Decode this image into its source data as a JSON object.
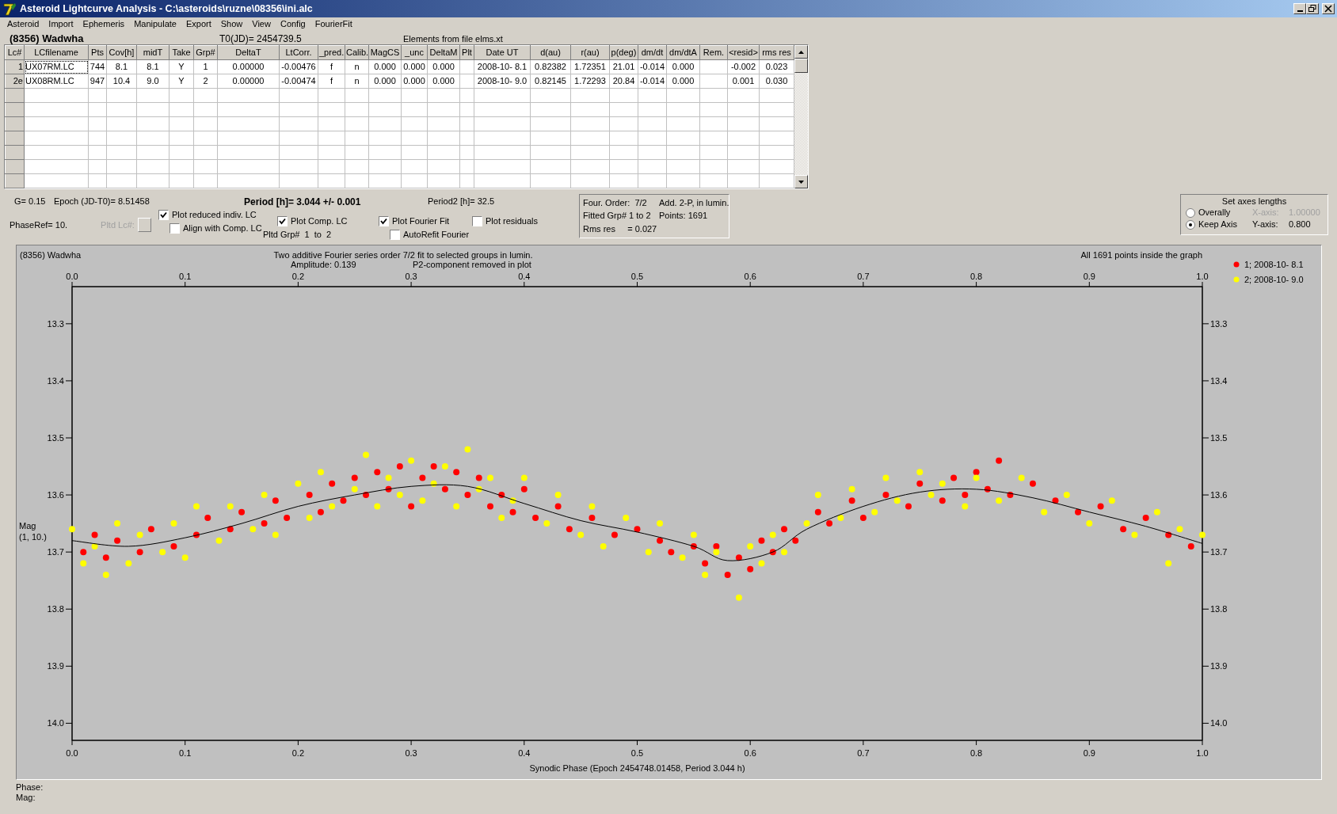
{
  "window": {
    "title": "Asteroid Lightcurve Analysis - C:\\asteroids\\ruzne\\08356\\ini.alc"
  },
  "menu": [
    "Asteroid",
    "Import",
    "Ephemeris",
    "Manipulate",
    "Export",
    "Show",
    "View",
    "Config",
    "FourierFit"
  ],
  "header": {
    "asteroid": "(8356) Wadwha",
    "t0": "T0(JD)= 2454739.5",
    "elements": "Elements from file elms.xt"
  },
  "table": {
    "columns": [
      "Lc#",
      "LCfilename",
      "Pts",
      "Cov[h]",
      "midT",
      "Take",
      "Grp#",
      "DeltaT",
      "LtCorr.",
      "_pred.",
      "Calib.",
      "MagCS",
      "_unc",
      "DeltaM",
      "Plt",
      "Date UT",
      "d(au)",
      "r(au)",
      "p(deg)",
      "dm/dt",
      "dm/dtA",
      "Rem.",
      "<resid>",
      "rms res"
    ],
    "rows": [
      {
        "focused": true,
        "cells": [
          "1",
          "UX07RM.LC",
          "744",
          "8.1",
          "8.1",
          "Y",
          "1",
          "0.00000",
          "-0.00476",
          "f",
          "n",
          "0.000",
          "0.000",
          "0.000",
          "",
          "2008-10- 8.1",
          "0.82382",
          "1.72351",
          "21.01",
          "-0.014",
          "0.000",
          "",
          "-0.002",
          "0.023"
        ]
      },
      {
        "focused": false,
        "cells": [
          "2e",
          "UX08RM.LC",
          "947",
          "10.4",
          "9.0",
          "Y",
          "2",
          "0.00000",
          "-0.00474",
          "f",
          "n",
          "0.000",
          "0.000",
          "0.000",
          "",
          "2008-10- 9.0",
          "0.82145",
          "1.72293",
          "20.84",
          "-0.014",
          "0.000",
          "",
          "0.001",
          "0.030"
        ]
      }
    ]
  },
  "controls": {
    "g": "G= 0.15",
    "epoch": "Epoch (JD-T0)= 8.51458",
    "period": "Period [h]= 3.044 +/- 0.001",
    "period2": "Period2 [h]= 32.5",
    "phase_ref": "PhaseRef= 10.",
    "pltd_lc": {
      "label": "Pltd Lc#:",
      "disabled": true
    },
    "pltd_grp": "Pltd Grp#  1  to  2",
    "checkboxes": [
      {
        "label": "Plot reduced indiv. LC",
        "checked": true
      },
      {
        "label": "Align with Comp. LC",
        "checked": false
      },
      {
        "label": "Plot Comp. LC",
        "checked": true
      },
      {
        "label": "Plot Fourier Fit",
        "checked": true
      },
      {
        "label": "AutoRefit Fourier",
        "checked": false
      },
      {
        "label": "Plot residuals",
        "checked": false
      }
    ]
  },
  "fit_info": [
    "Four. Order:  7/2",
    "Add. 2-P, in lumin.",
    "Fitted Grp# 1 to 2",
    "Points: 1691",
    "Rms res     = 0.027"
  ],
  "axes": {
    "title": "Set axes lengths",
    "options": [
      {
        "label": "Overally",
        "selected": false,
        "axis_label": "X-axis:",
        "value": "1.00000",
        "disabled": true
      },
      {
        "label": "Keep Axis",
        "selected": true,
        "axis_label": "Y-axis:",
        "value": "0.800",
        "disabled": false
      }
    ]
  },
  "graph": {
    "object": "(8356) Wadwha",
    "title": "Two additive Fourier series order 7/2 fit to selected groups in lumin.",
    "subtitle_left": "Amplitude: 0.139",
    "subtitle_right": "P2-component removed in plot",
    "status": "All 1691 points inside the graph",
    "chart_data": {
      "type": "scatter",
      "legend": "right",
      "xlabel": "Synodic Phase (Epoch 2454748.01458, Period 3.044 h)",
      "ylabel": "Mag (1, 10.)",
      "xlim": [
        0,
        1
      ],
      "ylim": [
        14.03,
        13.235
      ],
      "xticks": [
        {
          "value": 0,
          "label": "0.0"
        },
        {
          "value": 0.1,
          "label": "0.1"
        },
        {
          "value": 0.2,
          "label": "0.2"
        },
        {
          "value": 0.3,
          "label": "0.3"
        },
        {
          "value": 0.4,
          "label": "0.4"
        },
        {
          "value": 0.5,
          "label": "0.5"
        },
        {
          "value": 0.6,
          "label": "0.6"
        },
        {
          "value": 0.7,
          "label": "0.7"
        },
        {
          "value": 0.8,
          "label": "0.8"
        },
        {
          "value": 0.9,
          "label": "0.9"
        },
        {
          "value": 1,
          "label": "1.0"
        }
      ],
      "yticks": [
        {
          "value": 13.3,
          "label": "13.3"
        },
        {
          "value": 13.4,
          "label": "13.4"
        },
        {
          "value": 13.5,
          "label": "13.5"
        },
        {
          "value": 13.6,
          "label": "13.6"
        },
        {
          "value": 13.7,
          "label": "13.7"
        },
        {
          "value": 13.8,
          "label": "13.8"
        },
        {
          "value": 13.9,
          "label": "13.9"
        },
        {
          "value": 14.0,
          "label": "14.0"
        }
      ],
      "series": [
        {
          "name": "1; 2008-10- 8.1",
          "color": "#ff0000",
          "x": [
            0.01,
            0.02,
            0.03,
            0.04,
            0.06,
            0.07,
            0.09,
            0.11,
            0.12,
            0.14,
            0.15,
            0.17,
            0.18,
            0.19,
            0.21,
            0.22,
            0.23,
            0.24,
            0.25,
            0.26,
            0.27,
            0.28,
            0.29,
            0.3,
            0.31,
            0.32,
            0.33,
            0.34,
            0.35,
            0.36,
            0.37,
            0.38,
            0.39,
            0.4,
            0.41,
            0.43,
            0.44,
            0.46,
            0.48,
            0.5,
            0.52,
            0.53,
            0.55,
            0.56,
            0.57,
            0.58,
            0.59,
            0.6,
            0.61,
            0.62,
            0.63,
            0.64,
            0.66,
            0.67,
            0.69,
            0.7,
            0.72,
            0.74,
            0.75,
            0.77,
            0.78,
            0.79,
            0.8,
            0.81,
            0.82,
            0.83,
            0.85,
            0.87,
            0.89,
            0.91,
            0.93,
            0.95,
            0.97,
            0.99
          ],
          "values": [
            13.7,
            13.67,
            13.71,
            13.68,
            13.7,
            13.66,
            13.69,
            13.67,
            13.64,
            13.66,
            13.63,
            13.65,
            13.61,
            13.64,
            13.6,
            13.63,
            13.58,
            13.61,
            13.57,
            13.6,
            13.56,
            13.59,
            13.55,
            13.62,
            13.57,
            13.55,
            13.59,
            13.56,
            13.6,
            13.57,
            13.62,
            13.6,
            13.63,
            13.59,
            13.64,
            13.62,
            13.66,
            13.64,
            13.67,
            13.66,
            13.68,
            13.7,
            13.69,
            13.72,
            13.69,
            13.74,
            13.71,
            13.73,
            13.68,
            13.7,
            13.66,
            13.68,
            13.63,
            13.65,
            13.61,
            13.64,
            13.6,
            13.62,
            13.58,
            13.61,
            13.57,
            13.6,
            13.56,
            13.59,
            13.54,
            13.6,
            13.58,
            13.61,
            13.63,
            13.62,
            13.66,
            13.64,
            13.67,
            13.69
          ]
        },
        {
          "name": "2; 2008-10- 9.0",
          "color": "#ffff00",
          "x": [
            0.0,
            0.01,
            0.02,
            0.03,
            0.04,
            0.05,
            0.06,
            0.08,
            0.09,
            0.1,
            0.11,
            0.13,
            0.14,
            0.16,
            0.17,
            0.18,
            0.2,
            0.21,
            0.22,
            0.23,
            0.25,
            0.26,
            0.27,
            0.28,
            0.29,
            0.3,
            0.31,
            0.32,
            0.33,
            0.34,
            0.35,
            0.36,
            0.37,
            0.38,
            0.39,
            0.4,
            0.42,
            0.43,
            0.45,
            0.46,
            0.47,
            0.49,
            0.51,
            0.52,
            0.54,
            0.55,
            0.56,
            0.57,
            0.59,
            0.6,
            0.61,
            0.62,
            0.63,
            0.65,
            0.66,
            0.68,
            0.69,
            0.71,
            0.72,
            0.73,
            0.75,
            0.76,
            0.77,
            0.79,
            0.8,
            0.82,
            0.84,
            0.86,
            0.88,
            0.9,
            0.92,
            0.94,
            0.96,
            0.97,
            0.98,
            1.0
          ],
          "values": [
            13.66,
            13.72,
            13.69,
            13.74,
            13.65,
            13.72,
            13.67,
            13.7,
            13.65,
            13.71,
            13.62,
            13.68,
            13.62,
            13.66,
            13.6,
            13.67,
            13.58,
            13.64,
            13.56,
            13.62,
            13.59,
            13.53,
            13.62,
            13.57,
            13.6,
            13.54,
            13.61,
            13.58,
            13.55,
            13.62,
            13.52,
            13.59,
            13.57,
            13.64,
            13.61,
            13.57,
            13.65,
            13.6,
            13.67,
            13.62,
            13.69,
            13.64,
            13.7,
            13.65,
            13.71,
            13.67,
            13.74,
            13.7,
            13.78,
            13.69,
            13.72,
            13.67,
            13.7,
            13.65,
            13.6,
            13.64,
            13.59,
            13.63,
            13.57,
            13.61,
            13.56,
            13.6,
            13.58,
            13.62,
            13.57,
            13.61,
            13.57,
            13.63,
            13.6,
            13.65,
            13.61,
            13.67,
            13.63,
            13.72,
            13.66,
            13.67
          ]
        },
        {
          "type": "line",
          "color": "#000000",
          "x": [
            0,
            0.05,
            0.1,
            0.15,
            0.2,
            0.25,
            0.3,
            0.35,
            0.4,
            0.45,
            0.5,
            0.55,
            0.58,
            0.62,
            0.65,
            0.7,
            0.75,
            0.8,
            0.85,
            0.9,
            0.95,
            1
          ],
          "values": [
            13.68,
            13.69,
            13.675,
            13.65,
            13.62,
            13.6,
            13.585,
            13.585,
            13.615,
            13.645,
            13.665,
            13.69,
            13.715,
            13.7,
            13.66,
            13.62,
            13.595,
            13.59,
            13.605,
            13.63,
            13.655,
            13.685
          ]
        }
      ]
    }
  },
  "status_bar": [
    "Phase:",
    "Mag:"
  ]
}
